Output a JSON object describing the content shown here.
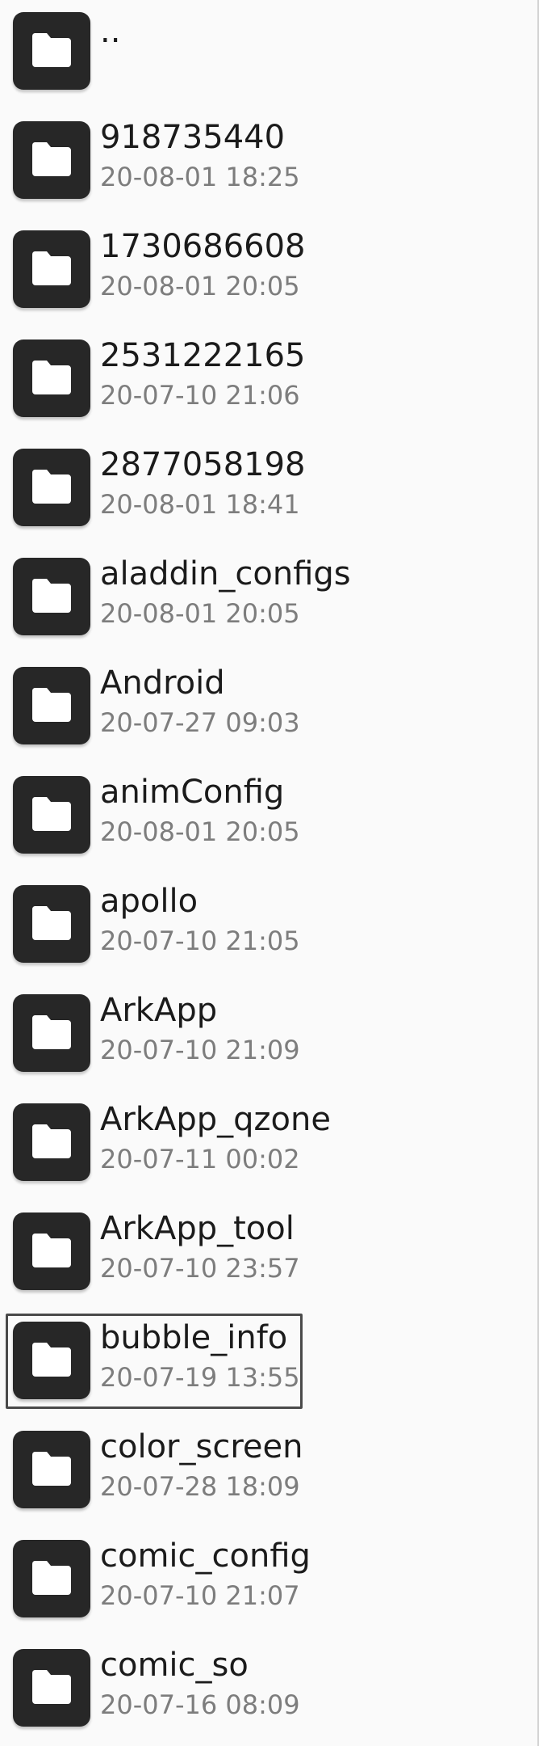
{
  "file_list": {
    "items": [
      {
        "name": "..",
        "date": "",
        "icon": "folder-icon"
      },
      {
        "name": "918735440",
        "date": "20-08-01 18:25",
        "icon": "folder-icon"
      },
      {
        "name": "1730686608",
        "date": "20-08-01 20:05",
        "icon": "folder-icon"
      },
      {
        "name": "2531222165",
        "date": "20-07-10 21:06",
        "icon": "folder-icon"
      },
      {
        "name": "2877058198",
        "date": "20-08-01 18:41",
        "icon": "folder-icon"
      },
      {
        "name": "aladdin_configs",
        "date": "20-08-01 20:05",
        "icon": "folder-icon"
      },
      {
        "name": "Android",
        "date": "20-07-27 09:03",
        "icon": "folder-icon"
      },
      {
        "name": "animConfig",
        "date": "20-08-01 20:05",
        "icon": "folder-icon"
      },
      {
        "name": "apollo",
        "date": "20-07-10 21:05",
        "icon": "folder-icon"
      },
      {
        "name": "ArkApp",
        "date": "20-07-10 21:09",
        "icon": "folder-icon"
      },
      {
        "name": "ArkApp_qzone",
        "date": "20-07-11 00:02",
        "icon": "folder-icon"
      },
      {
        "name": "ArkApp_tool",
        "date": "20-07-10 23:57",
        "icon": "folder-icon"
      },
      {
        "name": "bubble_info",
        "date": "20-07-19 13:55",
        "icon": "folder-icon",
        "selected": true
      },
      {
        "name": "color_screen",
        "date": "20-07-28 18:09",
        "icon": "folder-icon"
      },
      {
        "name": "comic_config",
        "date": "20-07-10 21:07",
        "icon": "folder-icon"
      },
      {
        "name": "comic_so",
        "date": "20-07-16 08:09",
        "icon": "folder-icon"
      }
    ]
  },
  "colors": {
    "background": "#fafafa",
    "folder_tile": "#272727",
    "folder_glyph": "#ffffff",
    "name_text": "#1b1b1b",
    "date_text": "#7d7d7d",
    "selection_border": "#4a4a4a"
  }
}
